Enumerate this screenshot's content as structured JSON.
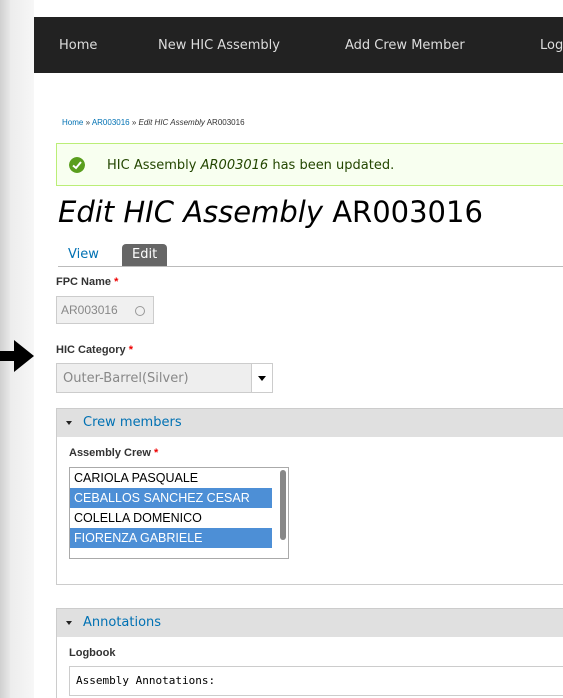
{
  "nav": {
    "items": [
      "Home",
      "New HIC Assembly",
      "Add Crew Member",
      "Log"
    ]
  },
  "breadcrumb": {
    "home": "Home",
    "sep1": "»",
    "item": "AR003016",
    "sep2": "»",
    "current_italic": "Edit HIC Assembly",
    "current_rest": "AR003016"
  },
  "status": {
    "pre": "HIC Assembly",
    "id": "AR003016",
    "post": "has been updated."
  },
  "title": {
    "italic": "Edit HIC Assembly",
    "rest": "AR003016"
  },
  "tabs": {
    "view": "View",
    "edit": "Edit"
  },
  "fpc": {
    "label": "FPC Name",
    "required": "*",
    "value": "AR003016"
  },
  "category": {
    "label": "HIC Category",
    "required": "*",
    "value": "Outer-Barrel(Silver)"
  },
  "crew": {
    "legend": "Crew members",
    "label": "Assembly Crew",
    "required": "*",
    "options": [
      {
        "name": "CARIOLA PASQUALE",
        "selected": false
      },
      {
        "name": "CEBALLOS SANCHEZ CESAR",
        "selected": true
      },
      {
        "name": "COLELLA DOMENICO",
        "selected": false
      },
      {
        "name": "FIORENZA GABRIELE",
        "selected": true
      }
    ]
  },
  "annotations": {
    "legend": "Annotations",
    "logbook_label": "Logbook",
    "logbook_value": "Assembly Annotations:"
  },
  "colors": {
    "nav_bg": "#222222",
    "link": "#0071b3",
    "success_bg": "#f8fff0",
    "success_icon": "#5a9e1e",
    "selected_option": "#4d8fd6",
    "required": "#ee0000"
  },
  "icons": {
    "status": "check-circle-icon",
    "pointer": "arrow-right-icon"
  }
}
